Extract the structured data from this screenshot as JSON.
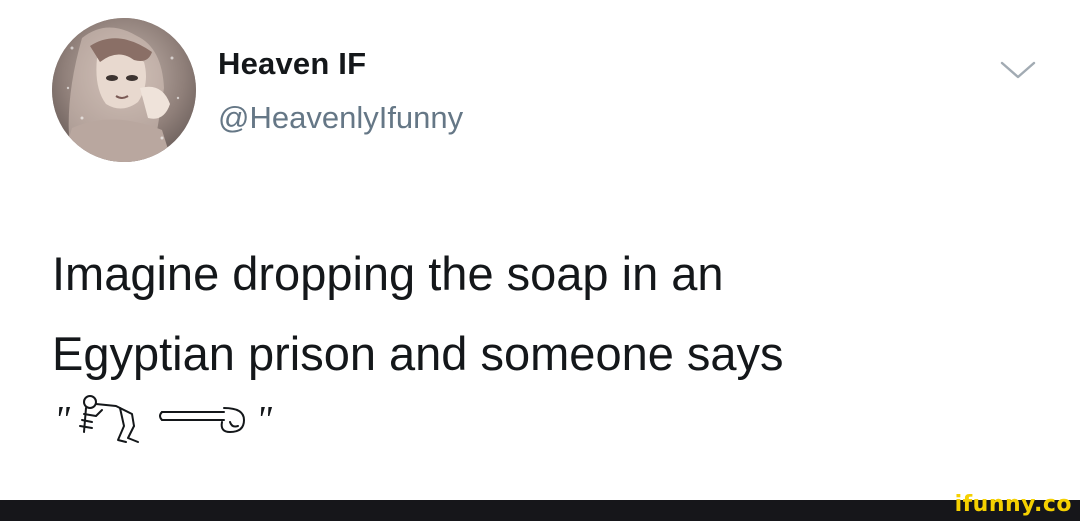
{
  "tweet": {
    "display_name": "Heaven IF",
    "handle": "@HeavenlyIfunny",
    "text_line_1": "Imagine dropping the soap in an",
    "text_line_2": "Egyptian prison and someone says",
    "quote_open": "\"",
    "quote_close": "\"",
    "glyphs": [
      "figure-bending-hieroglyph",
      "phallus-hieroglyph"
    ]
  },
  "icons": {
    "caret": "chevron-down-icon"
  },
  "footer": {
    "watermark": "ifunny.co",
    "watermark_color": "#f5d000",
    "background_color": "#16161a"
  }
}
